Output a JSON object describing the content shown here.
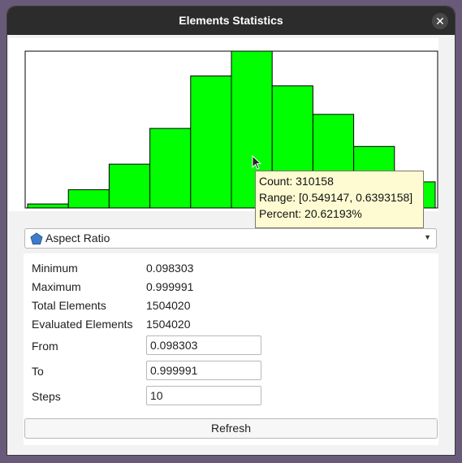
{
  "window": {
    "title": "Elements Statistics",
    "close_icon": "close-icon"
  },
  "chart_data": {
    "type": "bar",
    "title": "",
    "xlabel": "",
    "ylabel": "",
    "bar_color": "#00ff00",
    "bins": [
      {
        "range": [
          0.098303,
          0.1884718
        ],
        "count": 7900
      },
      {
        "range": [
          0.1884718,
          0.2786406
        ],
        "count": 36000
      },
      {
        "range": [
          0.2786406,
          0.3688094
        ],
        "count": 86600
      },
      {
        "range": [
          0.3688094,
          0.4589782
        ],
        "count": 157300
      },
      {
        "range": [
          0.4589782,
          0.549147
        ],
        "count": 261100
      },
      {
        "range": [
          0.549147,
          0.6393158
        ],
        "count": 310158
      },
      {
        "range": [
          0.6393158,
          0.7294846
        ],
        "count": 241500
      },
      {
        "range": [
          0.7294846,
          0.8196534
        ],
        "count": 185100
      },
      {
        "range": [
          0.8196534,
          0.9098222
        ],
        "count": 121700
      },
      {
        "range": [
          0.9098222,
          0.999991
        ],
        "count": 51600
      }
    ],
    "ylim": [
      0,
      310158
    ]
  },
  "tooltip": {
    "count": "Count: 310158",
    "range": "Range: [0.549147, 0.6393158]",
    "percent": "Percent: 20.62193%"
  },
  "metric_select": {
    "value": "Aspect Ratio",
    "icon": "pentagon-icon",
    "icon_color": "#3d7cc9"
  },
  "stats": {
    "minimum_label": "Minimum",
    "minimum_value": "0.098303",
    "maximum_label": "Maximum",
    "maximum_value": "0.999991",
    "total_label": "Total Elements",
    "total_value": "1504020",
    "evaluated_label": "Evaluated Elements",
    "evaluated_value": "1504020"
  },
  "form": {
    "from_label": "From",
    "from_value": "0.098303",
    "to_label": "To",
    "to_value": "0.999991",
    "steps_label": "Steps",
    "steps_value": "10"
  },
  "refresh_label": "Refresh"
}
